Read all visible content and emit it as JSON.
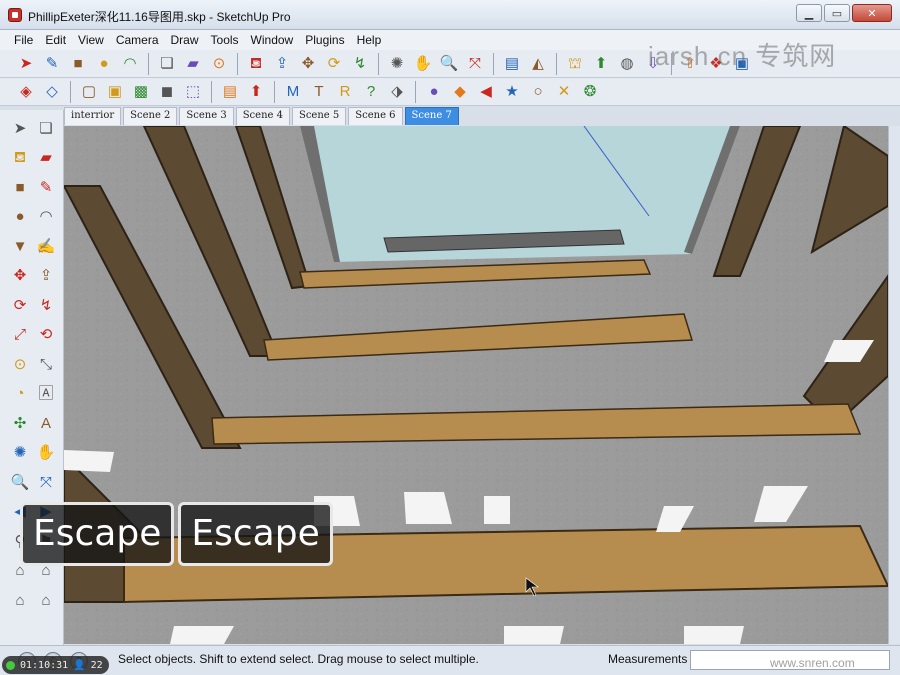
{
  "window": {
    "title": "PhillipExeter深化11.16导图用.skp - SketchUp Pro",
    "watermark_top": "iarsh.cn 专筑网",
    "watermark_bottom": "www.snren.com"
  },
  "menu": [
    "File",
    "Edit",
    "View",
    "Camera",
    "Draw",
    "Tools",
    "Window",
    "Plugins",
    "Help"
  ],
  "toolbar1": [
    {
      "icon": "select-arrow-icon",
      "glyph": "➤"
    },
    {
      "icon": "line-pencil-icon",
      "glyph": "✎"
    },
    {
      "icon": "rectangle-icon",
      "glyph": "■"
    },
    {
      "icon": "circle-icon",
      "glyph": "●"
    },
    {
      "icon": "arc-icon",
      "glyph": "◠"
    },
    {
      "icon": "make-component-icon",
      "glyph": "❏"
    },
    {
      "icon": "eraser-icon",
      "glyph": "▰"
    },
    {
      "icon": "tape-measure-icon",
      "glyph": "⊙"
    },
    {
      "icon": "paint-bucket-icon",
      "glyph": "⛾"
    },
    {
      "icon": "push-pull-icon",
      "glyph": "⇪"
    },
    {
      "icon": "move-icon",
      "glyph": "✥"
    },
    {
      "icon": "rotate-icon",
      "glyph": "⟳"
    },
    {
      "icon": "follow-me-icon",
      "glyph": "↯"
    },
    {
      "icon": "orbit-icon",
      "glyph": "✺"
    },
    {
      "icon": "pan-hand-icon",
      "glyph": "✋"
    },
    {
      "icon": "zoom-icon",
      "glyph": "🔍"
    },
    {
      "icon": "zoom-extents-icon",
      "glyph": "⤧"
    },
    {
      "icon": "add-location-icon",
      "glyph": "▤"
    },
    {
      "icon": "toggle-terrain-icon",
      "glyph": "◭"
    },
    {
      "icon": "get-models-icon",
      "glyph": "⛫"
    },
    {
      "icon": "share-model-icon",
      "glyph": "⬆"
    },
    {
      "icon": "google-earth-icon",
      "glyph": "◍"
    },
    {
      "icon": "get-photo-texture-icon",
      "glyph": "⇩"
    },
    {
      "icon": "share-component-icon",
      "glyph": "⇧"
    },
    {
      "icon": "extension-warehouse-icon",
      "glyph": "❖"
    },
    {
      "icon": "send-to-layout-icon",
      "glyph": "▣"
    }
  ],
  "toolbar2": [
    {
      "icon": "xray-face-style-icon",
      "glyph": "◈"
    },
    {
      "icon": "wireframe-style-icon",
      "glyph": "◇"
    },
    {
      "icon": "hidden-line-style-icon",
      "glyph": "▢"
    },
    {
      "icon": "shaded-style-icon",
      "glyph": "▣"
    },
    {
      "icon": "shaded-texture-style-icon",
      "glyph": "▩"
    },
    {
      "icon": "monochrome-style-icon",
      "glyph": "◼"
    },
    {
      "icon": "back-edges-style-icon",
      "glyph": "⬚"
    },
    {
      "icon": "material-swatch-icon",
      "glyph": "▤"
    },
    {
      "icon": "green-arrow-icon",
      "glyph": "⬆"
    },
    {
      "icon": "plugin-m-icon",
      "glyph": "M"
    },
    {
      "icon": "plugin-t-icon",
      "glyph": "T"
    },
    {
      "icon": "plugin-r-icon",
      "glyph": "R"
    },
    {
      "icon": "help-circle-icon",
      "glyph": "?"
    },
    {
      "icon": "tag-plugin-icon",
      "glyph": "⬗"
    },
    {
      "icon": "sphere-plugin-icon",
      "glyph": "●"
    },
    {
      "icon": "shadow-plugin-icon",
      "glyph": "◆"
    },
    {
      "icon": "leaf-plugin-icon",
      "glyph": "◀"
    },
    {
      "icon": "gold-star-icon",
      "glyph": "★"
    },
    {
      "icon": "white-sphere-icon",
      "glyph": "○"
    },
    {
      "icon": "cross-arrows-icon",
      "glyph": "✕"
    },
    {
      "icon": "rainbow-spiral-icon",
      "glyph": "❂"
    }
  ],
  "scenes": [
    "interrior",
    "Scene 2",
    "Scene 3",
    "Scene 4",
    "Scene 5",
    "Scene 6",
    "Scene 7"
  ],
  "active_scene": "Scene 7",
  "left_tools": [
    {
      "icon": "select-arrow-icon",
      "glyph": "➤",
      "c": "c-gray"
    },
    {
      "icon": "component-icon",
      "glyph": "❏",
      "c": "c-gray"
    },
    {
      "icon": "paint-bucket-icon",
      "glyph": "⛾",
      "c": "c-gold"
    },
    {
      "icon": "eraser-icon",
      "glyph": "▰",
      "c": "c-red"
    },
    {
      "icon": "rectangle-icon",
      "glyph": "■",
      "c": "c-brown"
    },
    {
      "icon": "line-pencil-icon",
      "glyph": "✎",
      "c": "c-red"
    },
    {
      "icon": "circle-icon",
      "glyph": "●",
      "c": "c-brown"
    },
    {
      "icon": "arc-icon",
      "glyph": "◠",
      "c": "c-gray"
    },
    {
      "icon": "polygon-icon",
      "glyph": "▼",
      "c": "c-brown"
    },
    {
      "icon": "freehand-icon",
      "glyph": "✍",
      "c": "c-gray"
    },
    {
      "icon": "move-icon",
      "glyph": "✥",
      "c": "c-red"
    },
    {
      "icon": "push-pull-icon",
      "glyph": "⇪",
      "c": "c-brown"
    },
    {
      "icon": "rotate-icon",
      "glyph": "⟳",
      "c": "c-red"
    },
    {
      "icon": "follow-me-icon",
      "glyph": "↯",
      "c": "c-red"
    },
    {
      "icon": "scale-icon",
      "glyph": "⤢",
      "c": "c-red"
    },
    {
      "icon": "offset-icon",
      "glyph": "⟲",
      "c": "c-red"
    },
    {
      "icon": "tape-measure-icon",
      "glyph": "⊙",
      "c": "c-gold"
    },
    {
      "icon": "dimension-icon",
      "glyph": "⤡",
      "c": "c-gray"
    },
    {
      "icon": "protractor-icon",
      "glyph": "◔",
      "c": "c-gold"
    },
    {
      "icon": "text-icon",
      "glyph": "🄰",
      "c": "c-gray"
    },
    {
      "icon": "axes-icon",
      "glyph": "✣",
      "c": "c-green"
    },
    {
      "icon": "3d-text-icon",
      "glyph": "A",
      "c": "c-brown"
    },
    {
      "icon": "orbit-icon",
      "glyph": "✺",
      "c": "c-blue"
    },
    {
      "icon": "pan-hand-icon",
      "glyph": "✋",
      "c": "c-gray"
    },
    {
      "icon": "zoom-icon",
      "glyph": "🔍",
      "c": "c-gray"
    },
    {
      "icon": "zoom-extents-icon",
      "glyph": "⤧",
      "c": "c-blue"
    },
    {
      "icon": "previous-view-icon",
      "glyph": "◀",
      "c": "c-blue"
    },
    {
      "icon": "next-view-icon",
      "glyph": "▶",
      "c": "c-blue"
    },
    {
      "icon": "position-camera-icon",
      "glyph": "⚲",
      "c": "c-gray"
    },
    {
      "icon": "walk-icon",
      "glyph": "⚑",
      "c": "c-gray"
    },
    {
      "icon": "house-view-icon",
      "glyph": "⌂",
      "c": "c-gray"
    },
    {
      "icon": "front-view-icon",
      "glyph": "⌂",
      "c": "c-gray"
    },
    {
      "icon": "back-view-icon",
      "glyph": "⌂",
      "c": "c-gray"
    },
    {
      "icon": "side-view-icon",
      "glyph": "⌂",
      "c": "c-gray"
    }
  ],
  "key_overlay": [
    "Escape",
    "Escape"
  ],
  "status": {
    "text": "Select objects. Shift to extend select. Drag mouse to select multiple.",
    "measurements_label": "Measurements",
    "measurements_value": "",
    "timer": "01:10:31",
    "timer_count": "22"
  },
  "colors": {
    "sky": "#b7d6d9",
    "concrete": "#9b9b9b",
    "wood_shelf": "#b78d4f",
    "dark_shelf": "#5c4a32",
    "active_tab": "#3d8de3"
  }
}
